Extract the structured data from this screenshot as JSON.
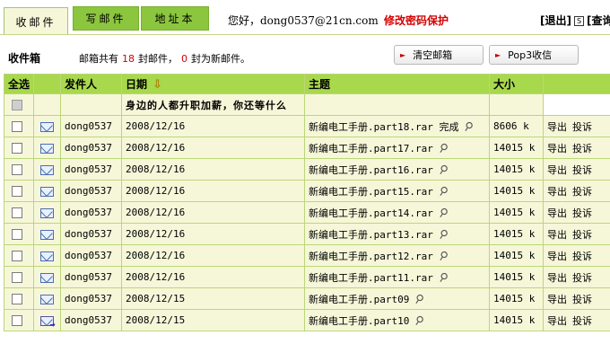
{
  "tabs": [
    {
      "label": "收邮件"
    },
    {
      "label": "写邮件"
    },
    {
      "label": "地址本"
    }
  ],
  "header": {
    "greeting": "您好，dong0537@21cn.com",
    "change_password": "修改密码保护",
    "logout": "[退出]",
    "query": "[查询"
  },
  "inbox": {
    "title": "收件箱",
    "summary_prefix": "邮箱共有",
    "total": "18",
    "summary_mid": "封邮件，",
    "unread": "0",
    "summary_suffix": "封为新邮件。"
  },
  "buttons": {
    "empty": "清空邮箱",
    "pop3": "Pop3收信"
  },
  "columns": {
    "select_all": "全选",
    "sender": "发件人",
    "date": "日期",
    "subject": "主题",
    "size": "大小"
  },
  "promo_text": "身边的人都升职加薪，你还等什么",
  "rows": [
    {
      "sender": "dong0537",
      "date": "2008/12/16",
      "subject": "新编电工手册.part18.rar 完成",
      "size": "8606 k",
      "export": "导出",
      "report": "投诉",
      "forwarded": false
    },
    {
      "sender": "dong0537",
      "date": "2008/12/16",
      "subject": "新编电工手册.part17.rar",
      "size": "14015 k",
      "export": "导出",
      "report": "投诉",
      "forwarded": false
    },
    {
      "sender": "dong0537",
      "date": "2008/12/16",
      "subject": "新编电工手册.part16.rar",
      "size": "14015 k",
      "export": "导出",
      "report": "投诉",
      "forwarded": false
    },
    {
      "sender": "dong0537",
      "date": "2008/12/16",
      "subject": "新编电工手册.part15.rar",
      "size": "14015 k",
      "export": "导出",
      "report": "投诉",
      "forwarded": false
    },
    {
      "sender": "dong0537",
      "date": "2008/12/16",
      "subject": "新编电工手册.part14.rar",
      "size": "14015 k",
      "export": "导出",
      "report": "投诉",
      "forwarded": false
    },
    {
      "sender": "dong0537",
      "date": "2008/12/16",
      "subject": "新编电工手册.part13.rar",
      "size": "14015 k",
      "export": "导出",
      "report": "投诉",
      "forwarded": false
    },
    {
      "sender": "dong0537",
      "date": "2008/12/16",
      "subject": "新编电工手册.part12.rar",
      "size": "14015 k",
      "export": "导出",
      "report": "投诉",
      "forwarded": false
    },
    {
      "sender": "dong0537",
      "date": "2008/12/16",
      "subject": "新编电工手册.part11.rar",
      "size": "14015 k",
      "export": "导出",
      "report": "投诉",
      "forwarded": false
    },
    {
      "sender": "dong0537",
      "date": "2008/12/15",
      "subject": "新编电工手册.part09",
      "size": "14015 k",
      "export": "导出",
      "report": "投诉",
      "forwarded": false
    },
    {
      "sender": "dong0537",
      "date": "2008/12/15",
      "subject": "新编电工手册.part10",
      "size": "14015 k",
      "export": "导出",
      "report": "投诉",
      "forwarded": true
    }
  ]
}
